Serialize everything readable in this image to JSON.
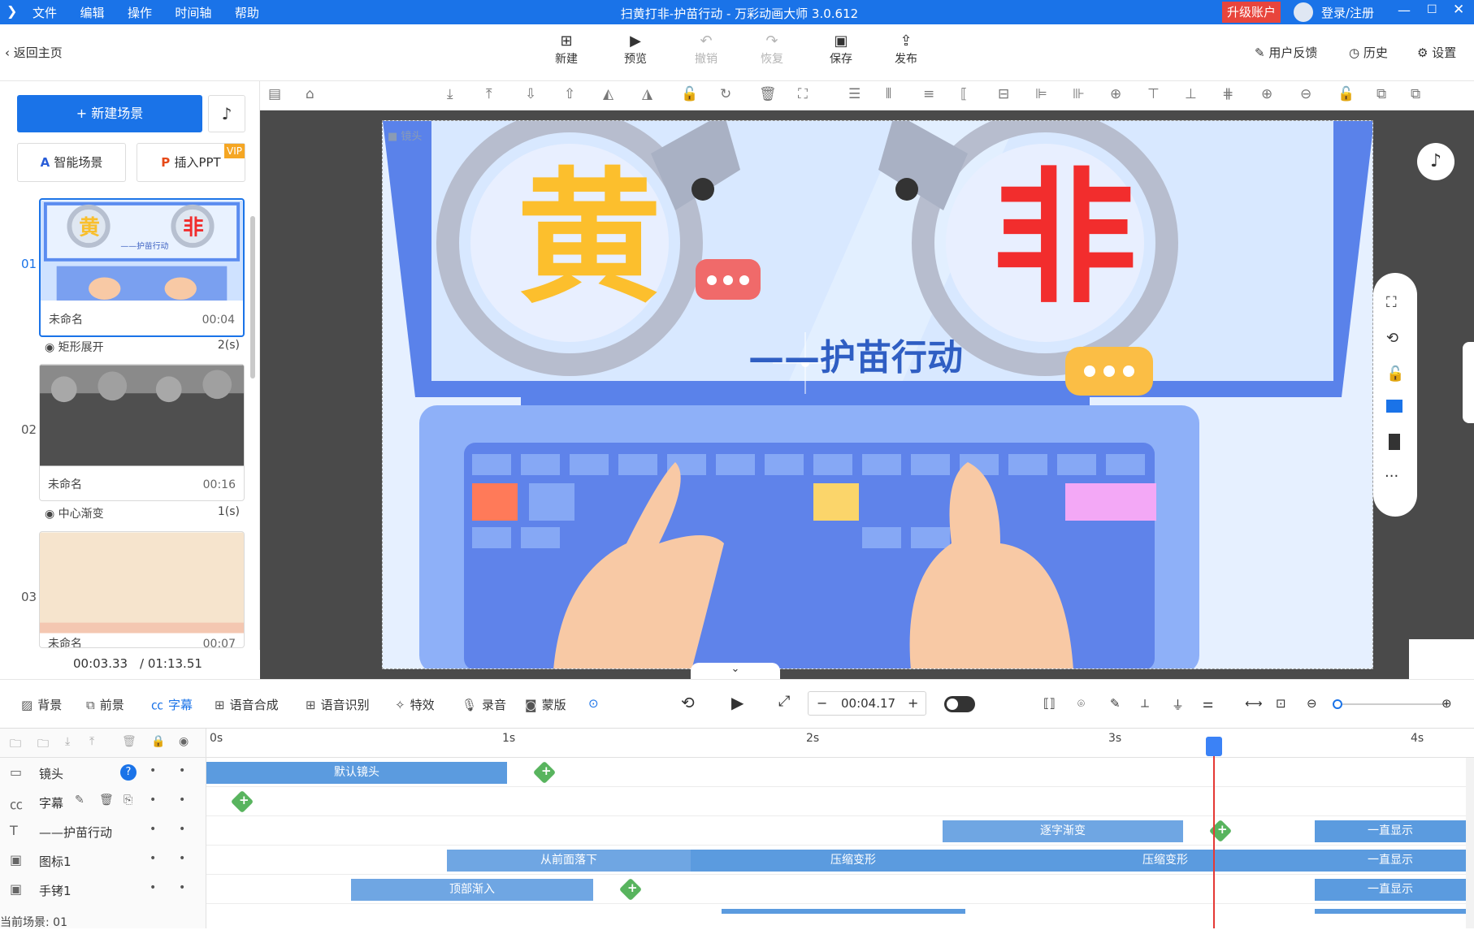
{
  "title_bar": {
    "menu": [
      "文件",
      "编辑",
      "操作",
      "时间轴",
      "帮助"
    ],
    "window_title": "扫黄打非-护苗行动 - 万彩动画大师 3.0.612",
    "upgrade_label": "升级账户",
    "login_label": "登录/注册",
    "min_icon": "minimize-icon",
    "max_icon": "maximize-icon",
    "close_icon": "close-icon"
  },
  "toolbar": {
    "back_label": "返回主页",
    "buttons": [
      {
        "label": "新建",
        "icon": "new-icon"
      },
      {
        "label": "预览",
        "icon": "play-icon"
      },
      {
        "label": "撤销",
        "icon": "undo-icon",
        "disabled": true
      },
      {
        "label": "恢复",
        "icon": "redo-icon",
        "disabled": true
      },
      {
        "label": "保存",
        "icon": "save-icon"
      },
      {
        "label": "发布",
        "icon": "publish-icon"
      }
    ],
    "feedback_label": "用户反馈",
    "history_label": "历史",
    "settings_label": "设置"
  },
  "left_panel": {
    "new_scene_label": "+ 新建场景",
    "smart_scene_label": "智能场景",
    "insert_ppt_label": "插入PPT",
    "vip_badge": "VIP",
    "scenes": [
      {
        "num": "01",
        "name": "未命名",
        "duration": "00:04"
      },
      {
        "num": "02",
        "name": "未命名",
        "duration": "00:16"
      },
      {
        "num": "03",
        "name": "未命名",
        "duration": "00:07"
      }
    ],
    "transitions": [
      {
        "name": "矩形展开",
        "duration": "2(s)"
      },
      {
        "name": "中心渐变",
        "duration": "1(s)"
      }
    ],
    "current_time": "00:03.33",
    "total_time": "/ 01:13.51"
  },
  "stage": {
    "camera_label": "镜头",
    "char_left": "黄",
    "char_right": "非",
    "subtitle": "——护苗行动"
  },
  "bottom_bar": {
    "tools": [
      "背景",
      "前景",
      "字幕",
      "语音合成",
      "语音识别",
      "特效",
      "录音",
      "蒙版"
    ],
    "time_value": "00:04.17"
  },
  "timeline": {
    "ticks": [
      "0s",
      "1s",
      "2s",
      "3s",
      "4s"
    ],
    "rows": [
      {
        "name": "镜头",
        "icon": "camera-icon"
      },
      {
        "name": "字幕",
        "icon": "cc-icon"
      },
      {
        "name": "——护苗行动",
        "icon": "text-icon"
      },
      {
        "name": "图标1",
        "icon": "image-icon"
      },
      {
        "name": "手铐1",
        "icon": "image-icon"
      }
    ],
    "segments": {
      "camera": "默认镜头",
      "text_fade": "逐字渐变",
      "always_show": "一直显示",
      "fall_front": "从前面落下",
      "compress": "压缩变形",
      "top_fade": "顶部渐入"
    },
    "current_scene_label": "当前场景: 01"
  },
  "colors": {
    "brand": "#1a73e8",
    "segment": "#5b9bdf",
    "keyframe": "#58b45e",
    "playhead": "#e53935"
  }
}
